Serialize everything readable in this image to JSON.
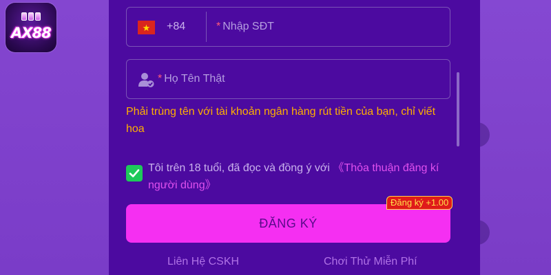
{
  "app": {
    "logo_text": "AX88"
  },
  "form": {
    "phone": {
      "country_code": "+84",
      "required_mark": "*",
      "placeholder": "Nhập SĐT"
    },
    "name": {
      "required_mark": "*",
      "placeholder": "Họ Tên Thật"
    },
    "name_hint": "Phải trùng tên với tài khoản ngân hàng rút tiền của bạn, chỉ viết hoa",
    "agreement": {
      "checked": true,
      "text": "Tôi trên 18 tuổi, đã đọc và đồng ý với ",
      "link": "《Thỏa thuận đăng kí người dùng》"
    },
    "register_button": "ĐĂNG KÝ",
    "bonus_badge": "Đăng ký +1.00"
  },
  "footer": {
    "support_link": "Liên Hệ CSKH",
    "free_play_link": "Chơi Thử Miễn Phí"
  },
  "colors": {
    "panel_bg": "#4c0aa0",
    "button_bg": "#f52ff2",
    "hint": "#ffb000",
    "checkbox": "#1ec95a",
    "link": "#e050ee"
  }
}
